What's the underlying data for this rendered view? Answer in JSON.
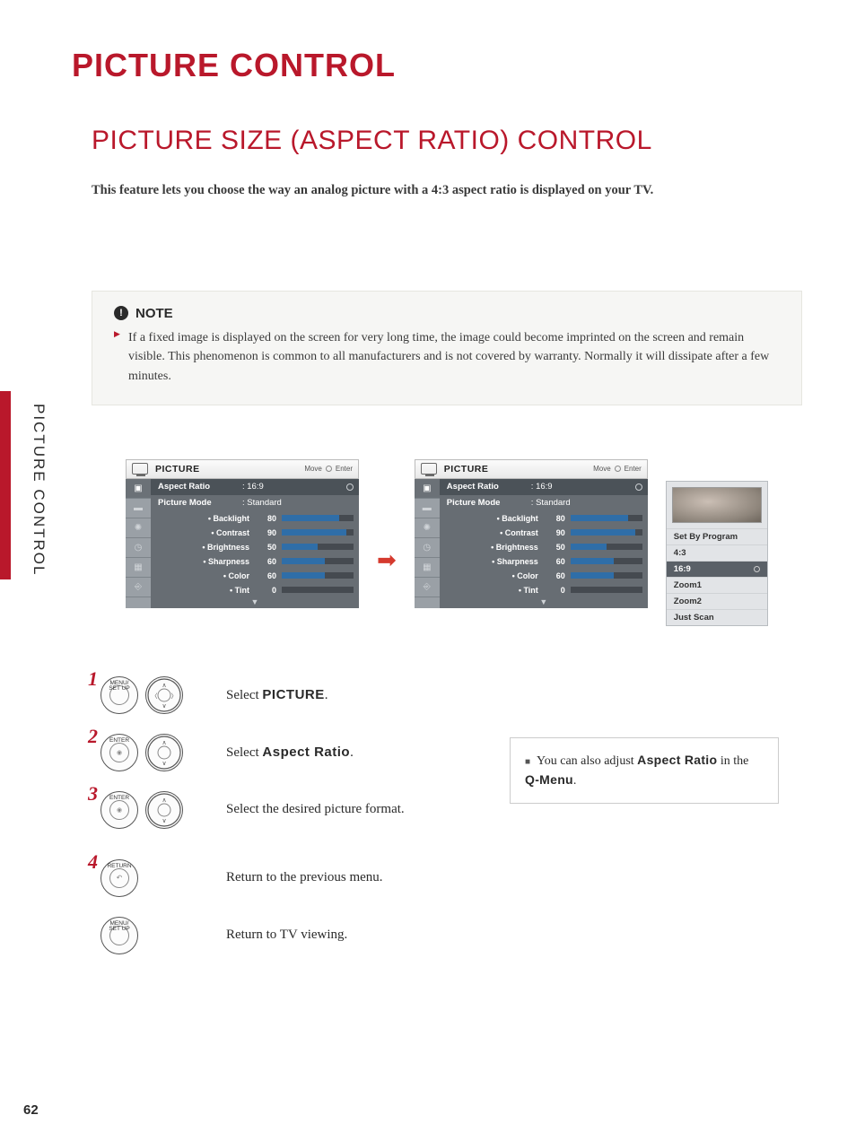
{
  "page_number": "62",
  "side_label": "PICTURE CONTROL",
  "title": "PICTURE CONTROL",
  "subtitle": "PICTURE SIZE (ASPECT RATIO) CONTROL",
  "intro": "This feature lets you choose the way an analog picture with a 4:3 aspect ratio is displayed on your TV.",
  "note": {
    "heading": "NOTE",
    "body": "If a fixed image is displayed on the screen for very long time, the image could become imprinted on the screen and remain visible. This phenomenon is common to all manufacturers and is not covered by warranty. Normally it will dissipate after a few minutes."
  },
  "osd": {
    "header_title": "PICTURE",
    "header_move": "Move",
    "header_enter": "Enter",
    "aspect_label": "Aspect Ratio",
    "aspect_value": ": 16:9",
    "mode_label": "Picture Mode",
    "mode_value": ": Standard",
    "settings": [
      {
        "label": "• Backlight",
        "value": "80",
        "pct": 80
      },
      {
        "label": "• Contrast",
        "value": "90",
        "pct": 90
      },
      {
        "label": "• Brightness",
        "value": "50",
        "pct": 50
      },
      {
        "label": "• Sharpness",
        "value": "60",
        "pct": 60
      },
      {
        "label": "• Color",
        "value": "60",
        "pct": 60
      },
      {
        "label": "• Tint",
        "value": "0",
        "pct": 0,
        "centered": true
      }
    ]
  },
  "popup": {
    "options": [
      {
        "label": "Set By Program"
      },
      {
        "label": "4:3"
      },
      {
        "label": "16:9",
        "selected": true
      },
      {
        "label": "Zoom1"
      },
      {
        "label": "Zoom2"
      },
      {
        "label": "Just Scan"
      }
    ]
  },
  "steps": {
    "s1": {
      "num": "1",
      "btn1": "MENU/\nSET UP",
      "pre": "Select ",
      "strong": "PICTURE",
      "post": "."
    },
    "s2": {
      "num": "2",
      "btn1": "ENTER",
      "pre": "Select ",
      "strong": "Aspect Ratio",
      "post": "."
    },
    "s3": {
      "num": "3",
      "btn1": "ENTER",
      "text": "Select the desired picture format."
    },
    "s4": {
      "num": "4",
      "btn1": "RETURN",
      "text": "Return to the previous menu."
    },
    "extra": {
      "btn1": "MENU/\nSET UP",
      "text": "Return to TV viewing."
    }
  },
  "tip": {
    "pre": "You can also adjust ",
    "s1": "Aspect Ratio",
    "mid": " in the ",
    "s2": "Q-Menu",
    "post": "."
  }
}
